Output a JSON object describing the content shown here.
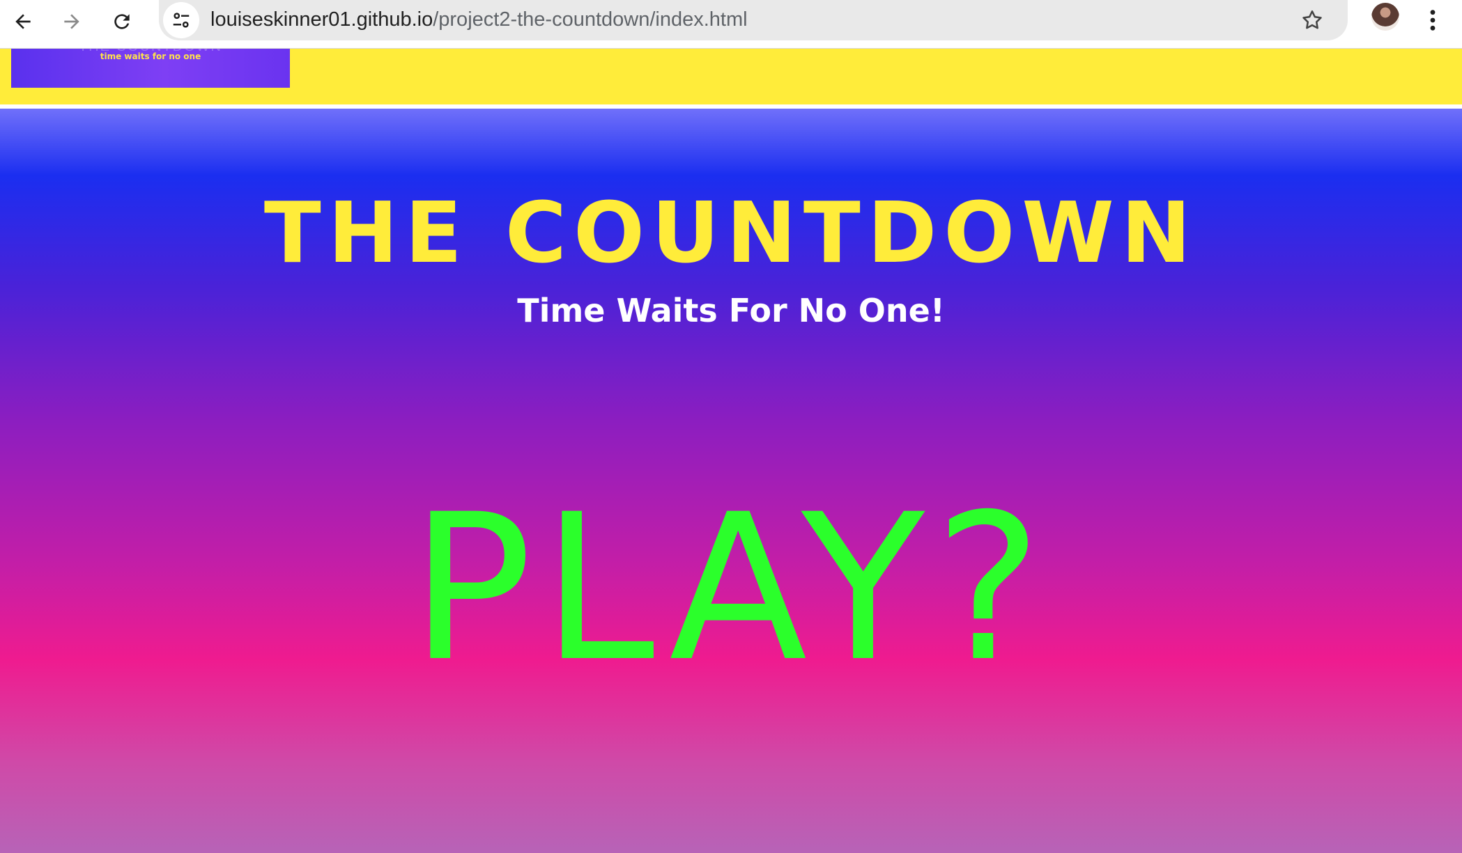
{
  "browser": {
    "url_host": "louiseskinner01.github.io",
    "url_path": "/project2-the-countdown/index.html",
    "icons": [
      "back-arrow-icon",
      "forward-arrow-icon",
      "reload-icon",
      "site-info-icon",
      "bookmark-star-icon",
      "profile-avatar",
      "kebab-menu-icon"
    ]
  },
  "header": {
    "logo_title": "THE COUNTDOWN",
    "logo_tagline": "time waits for no one"
  },
  "hero": {
    "title": "THE COUNTDOWN",
    "subtitle": "Time Waits For No One!",
    "play_label": "PLAY?"
  },
  "colors": {
    "topbar": "#ffec3a",
    "title": "#ffec3a",
    "play": "#2bff2b",
    "gradient_top": "#1b2ef0",
    "gradient_mid": "#ef1b8f"
  }
}
